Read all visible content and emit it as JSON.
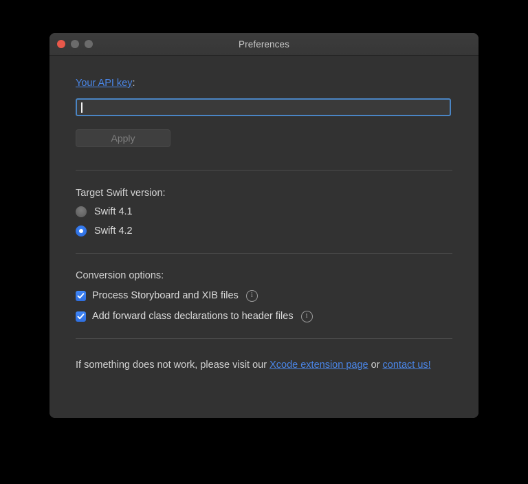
{
  "window": {
    "title": "Preferences",
    "traffic_lights": [
      {
        "name": "close",
        "color": "#e8584a"
      },
      {
        "name": "minimize",
        "color": "#6b6b6b"
      },
      {
        "name": "zoom",
        "color": "#6b6b6b"
      }
    ]
  },
  "api_key": {
    "label_link": "Your API key",
    "label_suffix": ":",
    "value": "",
    "placeholder": "",
    "apply_label": "Apply",
    "apply_enabled": false
  },
  "swift_version": {
    "label": "Target Swift version:",
    "options": [
      {
        "label": "Swift 4.1",
        "selected": false
      },
      {
        "label": "Swift 4.2",
        "selected": true
      }
    ]
  },
  "conversion_options": {
    "label": "Conversion options:",
    "items": [
      {
        "label": "Process Storyboard and XIB files",
        "checked": true,
        "info": "i"
      },
      {
        "label": "Add forward class declarations to header files",
        "checked": true,
        "info": "i"
      }
    ]
  },
  "footer": {
    "text_before": "If something does not work, please visit our ",
    "link_1": "Xcode extension page",
    "text_middle": " or ",
    "link_2": "contact us!"
  },
  "colors": {
    "accent": "#2f6fe0",
    "link": "#4a86e8",
    "window_bg": "#323232",
    "titlebar_bg": "#3a3a3a",
    "focus_border": "#4a85c4"
  }
}
